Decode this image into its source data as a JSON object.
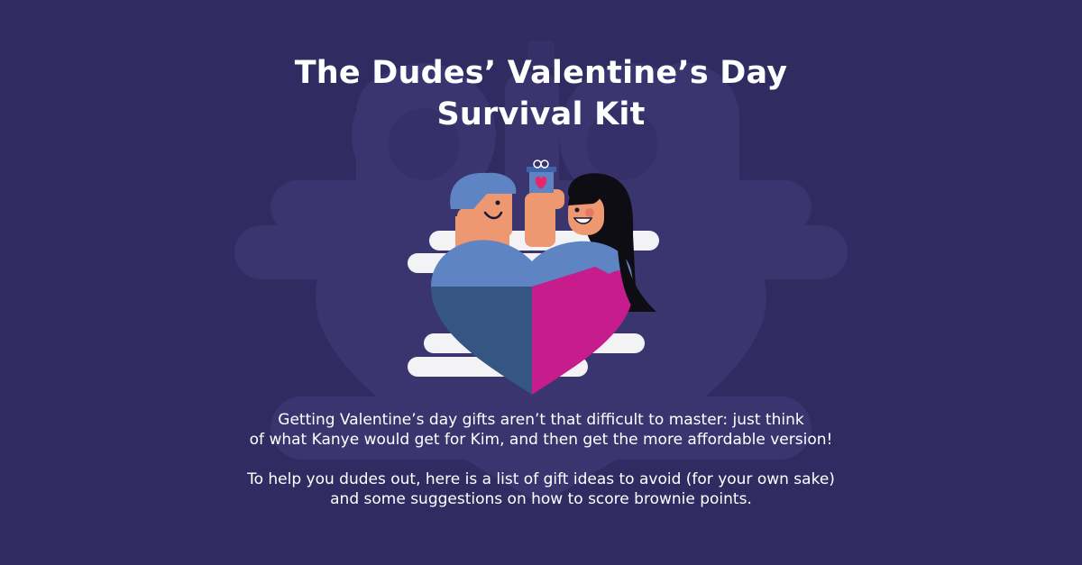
{
  "colors": {
    "background": "#302b61",
    "ghost": "#3b3570",
    "cloud": "#f3f3f6",
    "heart_blue": "#5e84c4",
    "heart_dark": "#355683",
    "heart_pink": "#c71c8c",
    "skin": "#ee9872",
    "hair_blue": "#5e84c4",
    "hair_black": "#0f0d14",
    "gift_heart": "#e8246b"
  },
  "title": {
    "line1": "The Dudes’ Valentine’s Day",
    "line2": "Survival Kit"
  },
  "description": {
    "paragraph1_line1": "Getting Valentine’s day gifts aren’t that difficult to master: just think",
    "paragraph1_line2": "of what Kanye would get for Kim, and then get the more affordable version!",
    "paragraph2_line1": "To help you dudes out, here is a list of gift ideas to avoid (for your own sake)",
    "paragraph2_line2": "and some suggestions on how to score brownie points."
  },
  "illustration": {
    "icons": [
      "background-couple-silhouette",
      "clouds",
      "heart-icon",
      "man-figure",
      "woman-figure",
      "gift-box-icon"
    ]
  }
}
